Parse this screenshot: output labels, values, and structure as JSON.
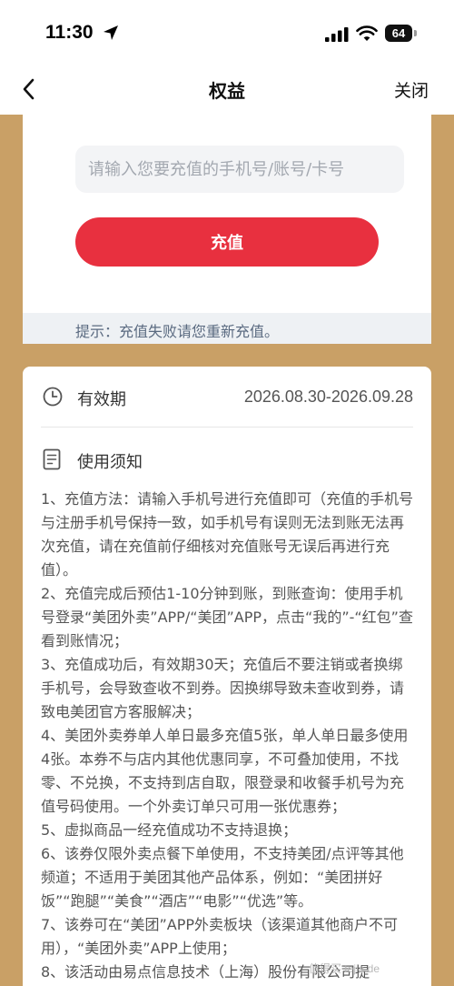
{
  "status_bar": {
    "time": "11:30",
    "battery_level": "64",
    "icons": [
      "location-arrow-icon",
      "signal-icon",
      "wifi-icon",
      "battery-icon"
    ]
  },
  "nav": {
    "back_icon": "chevron-left-icon",
    "title": "权益",
    "close_label": "关闭"
  },
  "recharge": {
    "input_placeholder": "请输入您要充值的手机号/账号/卡号",
    "input_value": "",
    "button_label": "充值",
    "tip": "提示：充值失败请您重新充值。"
  },
  "validity": {
    "icon": "clock-icon",
    "label": "有效期",
    "value": "2026.08.30-2026.09.28"
  },
  "notes": {
    "icon": "document-icon",
    "title": "使用须知",
    "items": [
      "1、充值方法：请输入手机号进行充值即可（充值的手机号与注册手机号保持一致，如手机号有误则无法到账无法再次充值，请在充值前仔细核对充值账号无误后再进行充值）。",
      "2、充值完成后预估1-10分钟到账，到账查询：使用手机号登录“美团外卖”APP/“美团”APP，点击“我的”-“红包”查看到账情况；",
      "3、充值成功后，有效期30天；充值后不要注销或者换绑手机号，会导致查收不到券。因换绑导致未查收到券，请致电美团官方客服解决；",
      "4、美团外卖券单人单日最多充值5张，单人单日最多使用4张。本券不与店内其他优惠同享，不可叠加使用，不找零、不兑换，不支持到店自取，限登录和收餐手机号为充值号码使用。一个外卖订单只可用一张优惠券；",
      "5、虚拟商品一经充值成功不支持退换；",
      "6、该券仅限外卖点餐下单使用，不支持美团/点评等其他频道；不适用于美团其他产品体系，例如：“美团拼好饭”“跑腿”“美食”“酒店”“电影”“优选”等。",
      "7、该券可在“美团”APP外卖板块（该渠道其他商户不可用），“美团外卖”APP上使用；",
      "8、该活动由易点信息技术（上海）股份有限公司提"
    ]
  },
  "watermark": "值得买 tejia.de"
}
